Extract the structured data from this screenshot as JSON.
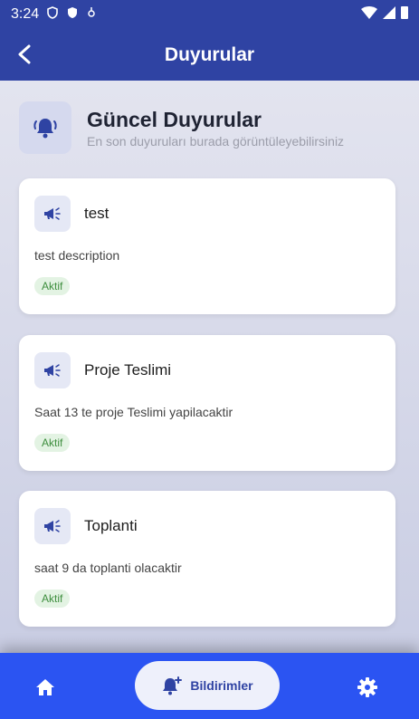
{
  "status_bar": {
    "time": "3:24"
  },
  "app_bar": {
    "title": "Duyurular"
  },
  "header": {
    "title": "Güncel Duyurular",
    "subtitle": "En son duyuruları burada görüntüleyebilirsiniz"
  },
  "announcements": [
    {
      "title": "test",
      "description": "test description",
      "status": "Aktif"
    },
    {
      "title": "Proje Teslimi",
      "description": "Saat 13 te proje Teslimi yapilacaktir",
      "status": "Aktif"
    },
    {
      "title": "Toplanti",
      "description": "saat 9 da toplanti olacaktir",
      "status": "Aktif"
    }
  ],
  "bottom_nav": {
    "center_label": "Bildirimler"
  },
  "colors": {
    "primary": "#2f43a3",
    "nav": "#2b54f2",
    "badge_bg": "#e3f3e3",
    "badge_text": "#3e8e3e"
  }
}
